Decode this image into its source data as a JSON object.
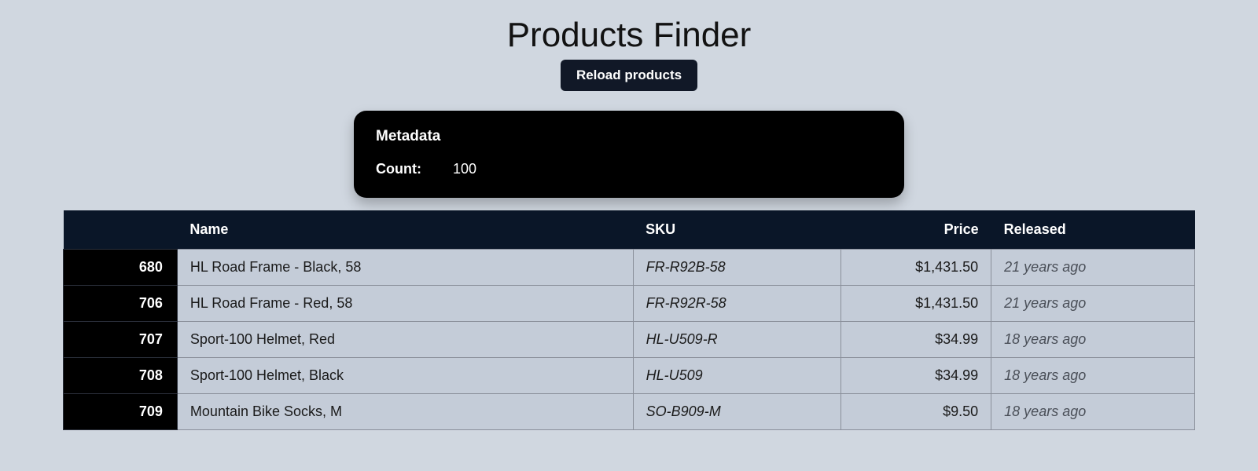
{
  "page": {
    "title": "Products Finder",
    "reload_label": "Reload products"
  },
  "metadata": {
    "heading": "Metadata",
    "count_label": "Count:",
    "count_value": "100"
  },
  "table": {
    "headers": {
      "id": "",
      "name": "Name",
      "sku": "SKU",
      "price": "Price",
      "released": "Released"
    },
    "rows": [
      {
        "id": "680",
        "name": "HL Road Frame - Black, 58",
        "sku": "FR-R92B-58",
        "price": "$1,431.50",
        "released": "21 years ago"
      },
      {
        "id": "706",
        "name": "HL Road Frame - Red, 58",
        "sku": "FR-R92R-58",
        "price": "$1,431.50",
        "released": "21 years ago"
      },
      {
        "id": "707",
        "name": "Sport-100 Helmet, Red",
        "sku": "HL-U509-R",
        "price": "$34.99",
        "released": "18 years ago"
      },
      {
        "id": "708",
        "name": "Sport-100 Helmet, Black",
        "sku": "HL-U509",
        "price": "$34.99",
        "released": "18 years ago"
      },
      {
        "id": "709",
        "name": "Mountain Bike Socks, M",
        "sku": "SO-B909-M",
        "price": "$9.50",
        "released": "18 years ago"
      }
    ]
  }
}
